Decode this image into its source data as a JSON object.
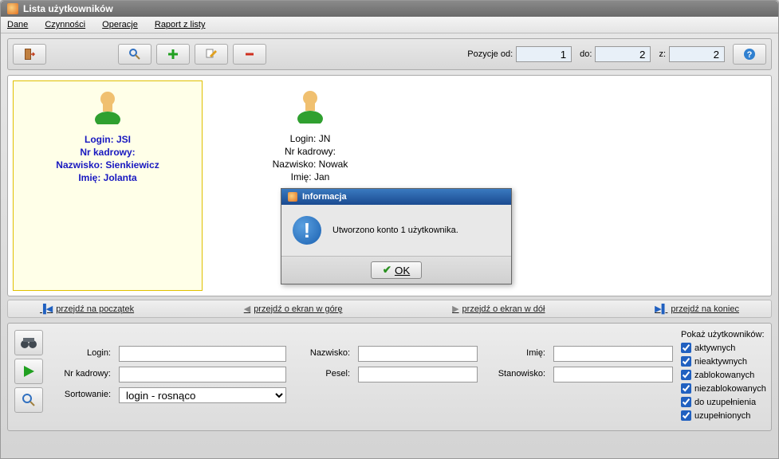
{
  "window": {
    "title": "Lista użytkowników"
  },
  "menu": {
    "dane": "Dane",
    "czynnosci": "Czynności",
    "operacje": "Operacje",
    "raport": "Raport z listy"
  },
  "toolbar": {
    "pos_od_label": "Pozycje od:",
    "pos_od": "1",
    "do_label": "do:",
    "do": "2",
    "z_label": "z:",
    "z": "2"
  },
  "users": [
    {
      "login_label": "Login:",
      "login": "JSI",
      "nr_label": "Nr kadrowy:",
      "nr": "",
      "nazwisko_label": "Nazwisko:",
      "nazwisko": "Sienkiewicz",
      "imie_label": "Imię:",
      "imie": "Jolanta"
    },
    {
      "login_label": "Login:",
      "login": "JN",
      "nr_label": "Nr kadrowy:",
      "nr": "",
      "nazwisko_label": "Nazwisko:",
      "nazwisko": "Nowak",
      "imie_label": "Imię:",
      "imie": "Jan"
    }
  ],
  "dialog": {
    "title": "Informacja",
    "message": "Utworzono konto 1 użytkownika.",
    "ok": "OK"
  },
  "nav": {
    "first": "przejdź na początek",
    "up": "przejdź o ekran w górę",
    "down": "przejdź o ekran w dół",
    "last": "przejdź na koniec"
  },
  "filters": {
    "login": "Login:",
    "nr": "Nr kadrowy:",
    "sort": "Sortowanie:",
    "sort_value": "login - rosnąco",
    "nazwisko": "Nazwisko:",
    "pesel": "Pesel:",
    "imie": "Imię:",
    "stanowisko": "Stanowisko:"
  },
  "show": {
    "header": "Pokaż użytkowników:",
    "aktywnych": "aktywnych",
    "nieaktywnych": "nieaktywnych",
    "zablokowanych": "zablokowanych",
    "niezablokowanych": "niezablokowanych",
    "do_uzup": "do uzupełnienia",
    "uzupelnionych": "uzupełnionych"
  }
}
